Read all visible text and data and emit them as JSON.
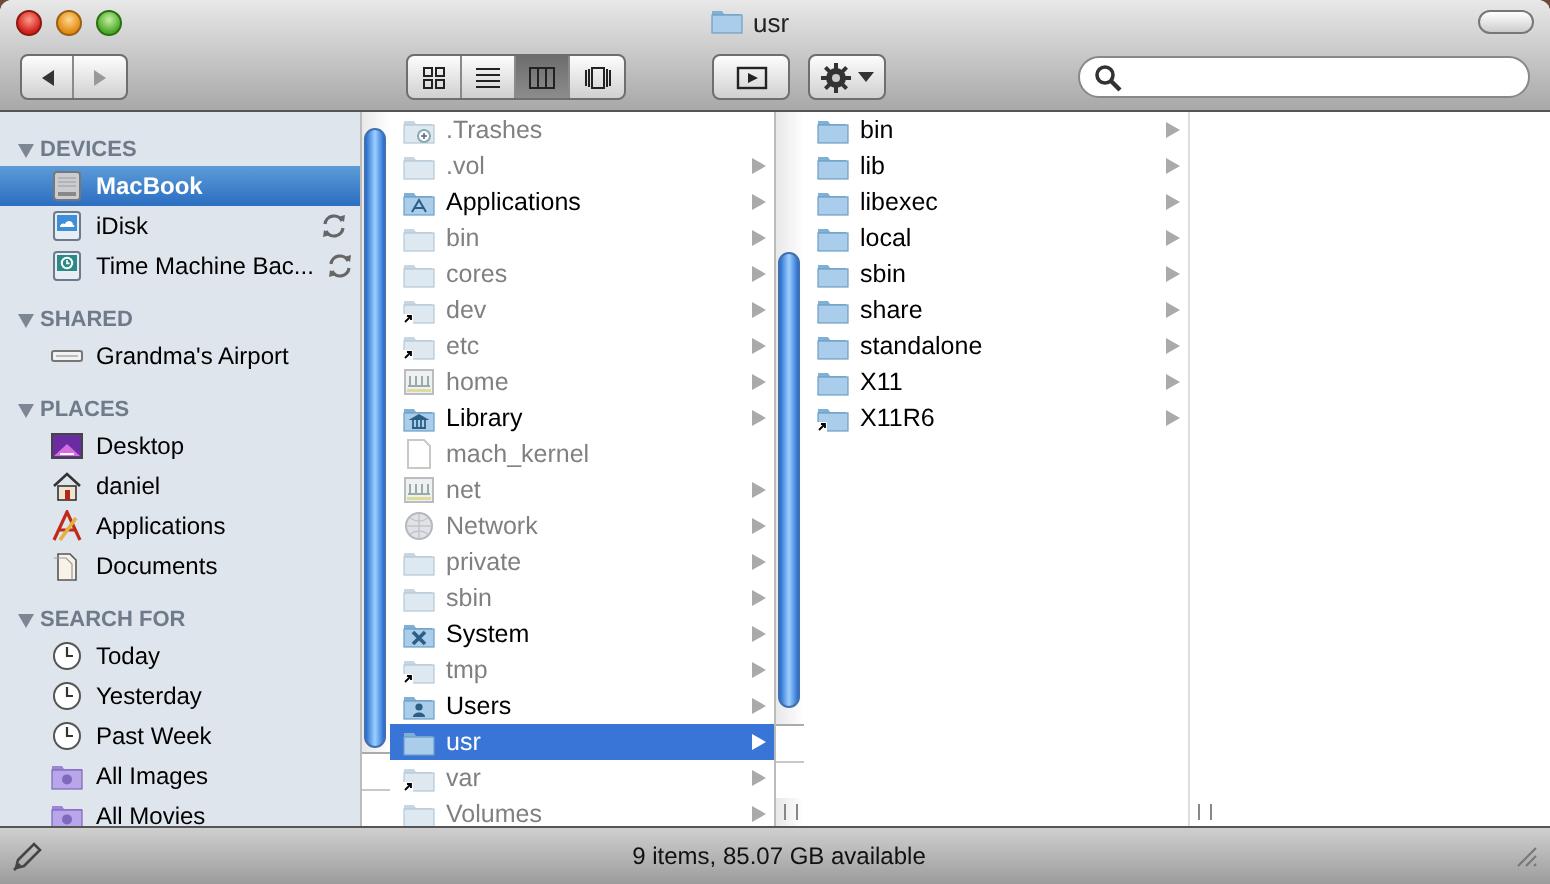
{
  "window": {
    "title": "usr"
  },
  "toolbar": {
    "views": [
      {
        "kind": "icon",
        "selected": false
      },
      {
        "kind": "list",
        "selected": false
      },
      {
        "kind": "columns",
        "selected": true
      },
      {
        "kind": "coverflow",
        "selected": false
      }
    ]
  },
  "sidebar": {
    "sections": [
      {
        "title": "DEVICES",
        "expanded": true,
        "items": [
          {
            "label": "MacBook",
            "kind": "disk",
            "selected": true,
            "sync": false
          },
          {
            "label": "iDisk",
            "kind": "idisk",
            "selected": false,
            "sync": true
          },
          {
            "label": "Time Machine Bac...",
            "kind": "timemachine",
            "selected": false,
            "sync": true
          }
        ]
      },
      {
        "title": "SHARED",
        "expanded": true,
        "items": [
          {
            "label": "Grandma's Airport",
            "kind": "server",
            "selected": false,
            "sync": false
          }
        ]
      },
      {
        "title": "PLACES",
        "expanded": true,
        "items": [
          {
            "label": "Desktop",
            "kind": "desktop",
            "selected": false,
            "sync": false
          },
          {
            "label": "daniel",
            "kind": "home",
            "selected": false,
            "sync": false
          },
          {
            "label": "Applications",
            "kind": "apps",
            "selected": false,
            "sync": false
          },
          {
            "label": "Documents",
            "kind": "docs",
            "selected": false,
            "sync": false
          }
        ]
      },
      {
        "title": "SEARCH FOR",
        "expanded": true,
        "items": [
          {
            "label": "Today",
            "kind": "clock",
            "selected": false,
            "sync": false
          },
          {
            "label": "Yesterday",
            "kind": "clock",
            "selected": false,
            "sync": false
          },
          {
            "label": "Past Week",
            "kind": "clock",
            "selected": false,
            "sync": false
          },
          {
            "label": "All Images",
            "kind": "smart",
            "selected": false,
            "sync": false
          },
          {
            "label": "All Movies",
            "kind": "smart",
            "selected": false,
            "sync": false
          }
        ]
      }
    ]
  },
  "columns": [
    {
      "items": [
        {
          "name": ".Trashes",
          "kind": "trash-folder",
          "dimmed": true,
          "selected": false,
          "arrow": false
        },
        {
          "name": ".vol",
          "kind": "folder",
          "dimmed": true,
          "selected": false,
          "arrow": true
        },
        {
          "name": "Applications",
          "kind": "apps-folder",
          "dimmed": false,
          "selected": false,
          "arrow": true
        },
        {
          "name": "bin",
          "kind": "folder",
          "dimmed": true,
          "selected": false,
          "arrow": true
        },
        {
          "name": "cores",
          "kind": "folder",
          "dimmed": true,
          "selected": false,
          "arrow": true
        },
        {
          "name": "dev",
          "kind": "alias-folder",
          "dimmed": true,
          "selected": false,
          "arrow": true
        },
        {
          "name": "etc",
          "kind": "alias-folder",
          "dimmed": true,
          "selected": false,
          "arrow": true
        },
        {
          "name": "home",
          "kind": "network-share",
          "dimmed": true,
          "selected": false,
          "arrow": true
        },
        {
          "name": "Library",
          "kind": "library-folder",
          "dimmed": false,
          "selected": false,
          "arrow": true
        },
        {
          "name": "mach_kernel",
          "kind": "file",
          "dimmed": true,
          "selected": false,
          "arrow": false
        },
        {
          "name": "net",
          "kind": "network-share",
          "dimmed": true,
          "selected": false,
          "arrow": true
        },
        {
          "name": "Network",
          "kind": "globe",
          "dimmed": true,
          "selected": false,
          "arrow": true
        },
        {
          "name": "private",
          "kind": "folder",
          "dimmed": true,
          "selected": false,
          "arrow": true
        },
        {
          "name": "sbin",
          "kind": "folder",
          "dimmed": true,
          "selected": false,
          "arrow": true
        },
        {
          "name": "System",
          "kind": "system-folder",
          "dimmed": false,
          "selected": false,
          "arrow": true
        },
        {
          "name": "tmp",
          "kind": "alias-folder",
          "dimmed": true,
          "selected": false,
          "arrow": true
        },
        {
          "name": "Users",
          "kind": "users-folder",
          "dimmed": false,
          "selected": false,
          "arrow": true
        },
        {
          "name": "usr",
          "kind": "folder",
          "dimmed": true,
          "selected": true,
          "arrow": true
        },
        {
          "name": "var",
          "kind": "alias-folder",
          "dimmed": true,
          "selected": false,
          "arrow": true
        },
        {
          "name": "Volumes",
          "kind": "folder",
          "dimmed": true,
          "selected": false,
          "arrow": true
        }
      ]
    },
    {
      "items": [
        {
          "name": "bin",
          "kind": "folder",
          "dimmed": false,
          "selected": false,
          "arrow": true
        },
        {
          "name": "lib",
          "kind": "folder",
          "dimmed": false,
          "selected": false,
          "arrow": true
        },
        {
          "name": "libexec",
          "kind": "folder",
          "dimmed": false,
          "selected": false,
          "arrow": true
        },
        {
          "name": "local",
          "kind": "folder",
          "dimmed": false,
          "selected": false,
          "arrow": true
        },
        {
          "name": "sbin",
          "kind": "folder",
          "dimmed": false,
          "selected": false,
          "arrow": true
        },
        {
          "name": "share",
          "kind": "folder",
          "dimmed": false,
          "selected": false,
          "arrow": true
        },
        {
          "name": "standalone",
          "kind": "folder",
          "dimmed": false,
          "selected": false,
          "arrow": true
        },
        {
          "name": "X11",
          "kind": "folder",
          "dimmed": false,
          "selected": false,
          "arrow": true
        },
        {
          "name": "X11R6",
          "kind": "alias-folder",
          "dimmed": false,
          "selected": false,
          "arrow": true
        }
      ]
    }
  ],
  "status_bar": {
    "text": "9 items, 85.07 GB available"
  }
}
